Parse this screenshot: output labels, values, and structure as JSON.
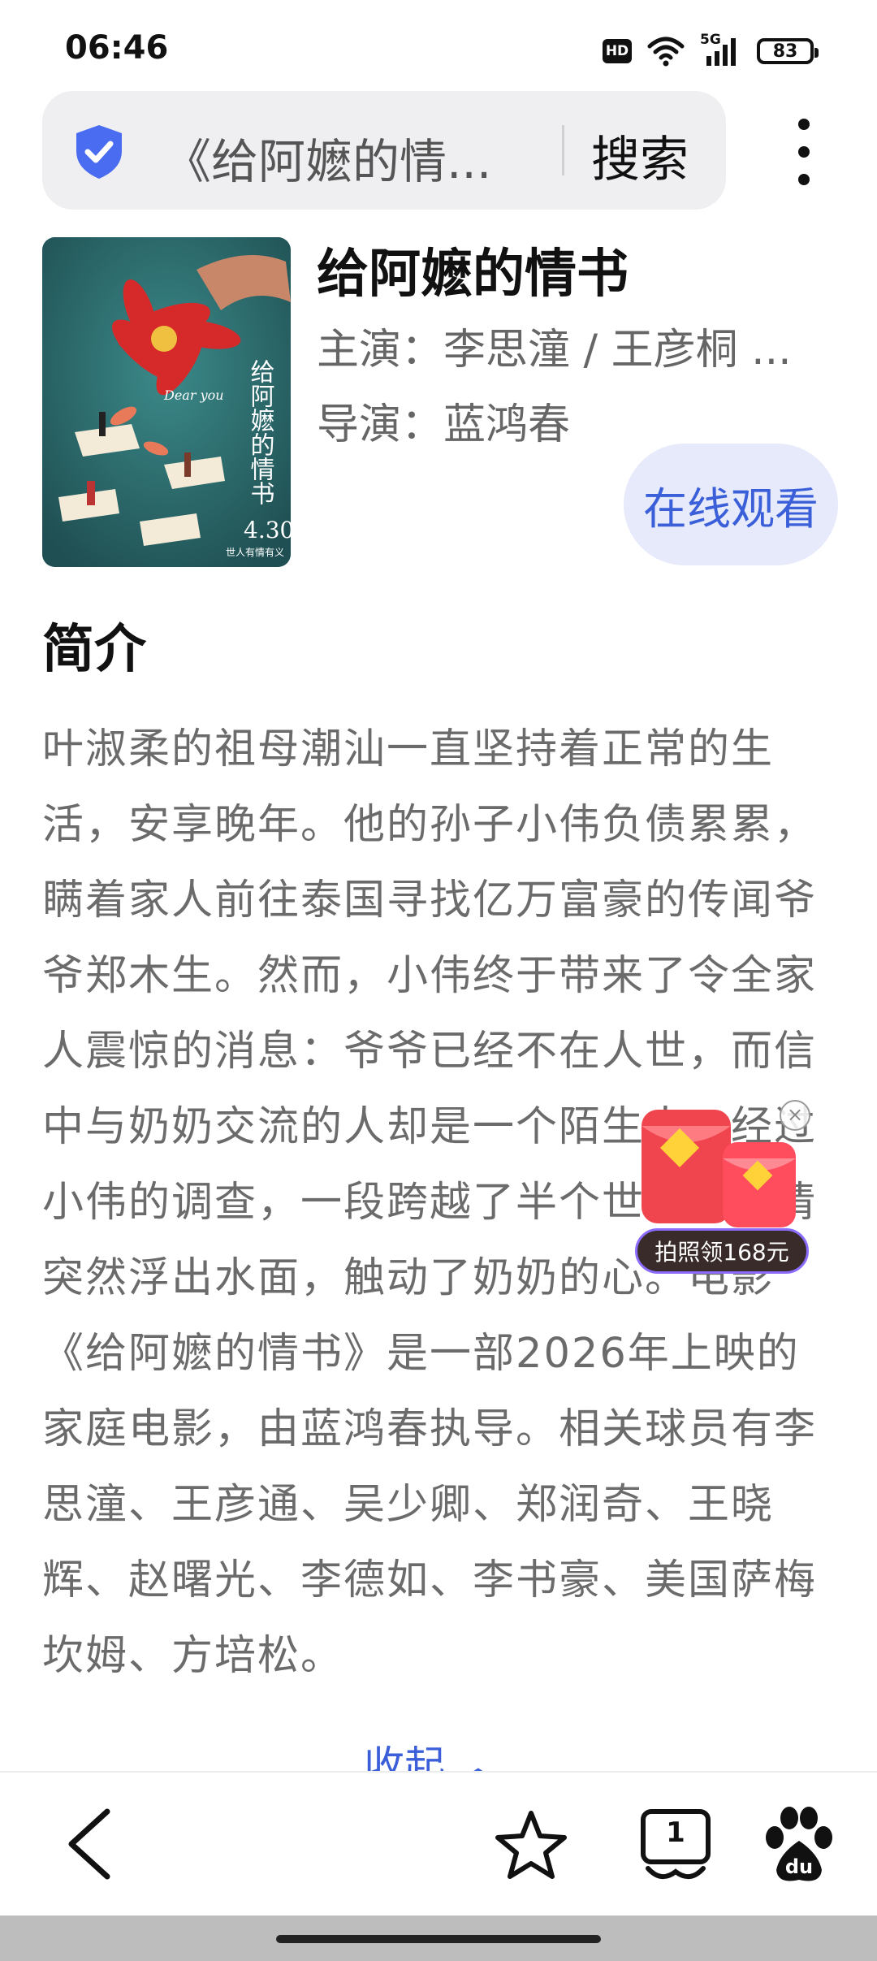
{
  "status_bar": {
    "time": "06:46",
    "hd_label": "HD",
    "network_label": "5G",
    "battery_level": "83"
  },
  "search": {
    "query": "《给阿嬷的情...",
    "button_label": "搜索"
  },
  "movie": {
    "title": "给阿嬷的情书",
    "cast": "主演：李思潼 / 王彦桐 ...",
    "director": "导演：蓝鸿春",
    "watch_label": "在线观看",
    "poster": {
      "vertical_title": "给阿嬷的情书",
      "date": "4.30",
      "tagline": "世人有情有义",
      "english": "Dear you"
    }
  },
  "intro": {
    "heading": "简介",
    "text": "叶淑柔的祖母潮汕一直坚持着正常的生活，安享晚年。他的孙子小伟负债累累，瞒着家人前往泰国寻找亿万富豪的传闻爷爷郑木生。然而，小伟终于带来了令全家人震惊的消息：爷爷已经不在人世，而信中与奶奶交流的人却是一个陌生人。经过小伟的调查，一段跨越了半个世纪的感情突然浮出水面，触动了奶奶的心。电影《给阿嬷的情书》是一部2026年上映的家庭电影，由蓝鸿春执导。相关球员有李思潼、王彦通、吴少卿、郑润奇、王晓辉、赵曙光、李德如、李书豪、美国萨梅坎姆、方培松。",
    "collapse_label": "收起 ︿"
  },
  "ad": {
    "label": "拍照领168元",
    "close_icon": "×"
  },
  "bottom_nav": {
    "tab_count": "1",
    "baidu_text": "du"
  },
  "colors": {
    "accent": "#3a5fd8",
    "watch_bg": "#e6eafb",
    "search_bg": "#efeff2",
    "shield": "#4a6cf0",
    "poster_bg": "#2e6f73"
  }
}
